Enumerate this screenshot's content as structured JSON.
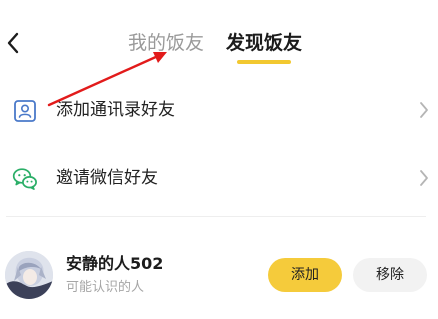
{
  "header": {
    "back_icon": "chevron-left-icon",
    "tabs": [
      {
        "label": "我的饭友",
        "active": false
      },
      {
        "label": "发现饭友",
        "active": true
      }
    ],
    "active_color": "#f2c830"
  },
  "menu": [
    {
      "icon": "contacts-book-icon",
      "label": "添加通讯录好友"
    },
    {
      "icon": "wechat-icon",
      "label": "邀请微信好友"
    }
  ],
  "suggestion": {
    "name": "安静的人502",
    "subtitle": "可能认识的人",
    "add_label": "添加",
    "remove_label": "移除"
  },
  "colors": {
    "accent": "#f5cb3b",
    "contacts_icon": "#4a79c9",
    "wechat_icon": "#2aae67",
    "annotation": "#e21b1b"
  }
}
